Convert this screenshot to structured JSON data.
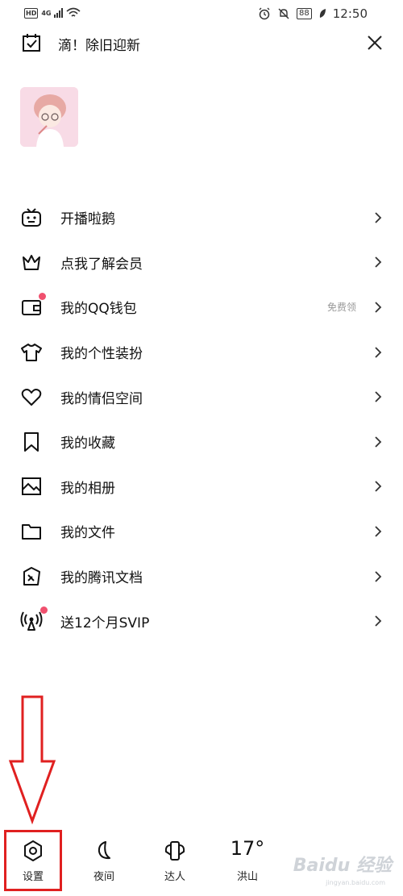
{
  "status_bar": {
    "hd": "HD",
    "network": "4G",
    "battery": "88",
    "time": "12:50"
  },
  "header": {
    "greeting": "滴！除旧迎新",
    "calendar_icon": "calendar-check-icon",
    "close_icon": "close-icon"
  },
  "menu": {
    "items": [
      {
        "label": "开播啦鹅",
        "icon": "tv-robot-icon"
      },
      {
        "label": "点我了解会员",
        "icon": "crown-icon"
      },
      {
        "label": "我的QQ钱包",
        "icon": "wallet-icon",
        "extra": "免费领"
      },
      {
        "label": "我的个性装扮",
        "icon": "tshirt-icon"
      },
      {
        "label": "我的情侣空间",
        "icon": "heart-icon"
      },
      {
        "label": "我的收藏",
        "icon": "bookmark-icon"
      },
      {
        "label": "我的相册",
        "icon": "photo-icon"
      },
      {
        "label": "我的文件",
        "icon": "folder-icon"
      },
      {
        "label": "我的腾讯文档",
        "icon": "document-icon"
      },
      {
        "label": "送12个月SVIP",
        "icon": "broadcast-icon"
      }
    ]
  },
  "bottom_bar": {
    "settings_label": "设置",
    "night_label": "夜间",
    "talent_label": "达人",
    "weather_temp": "17°",
    "weather_city": "洪山"
  },
  "watermark": {
    "text": "Baidu 经验",
    "sub": "jingyan.baidu.com"
  },
  "colors": {
    "accent_red": "#e02020",
    "badge_dot": "#f0506e"
  }
}
